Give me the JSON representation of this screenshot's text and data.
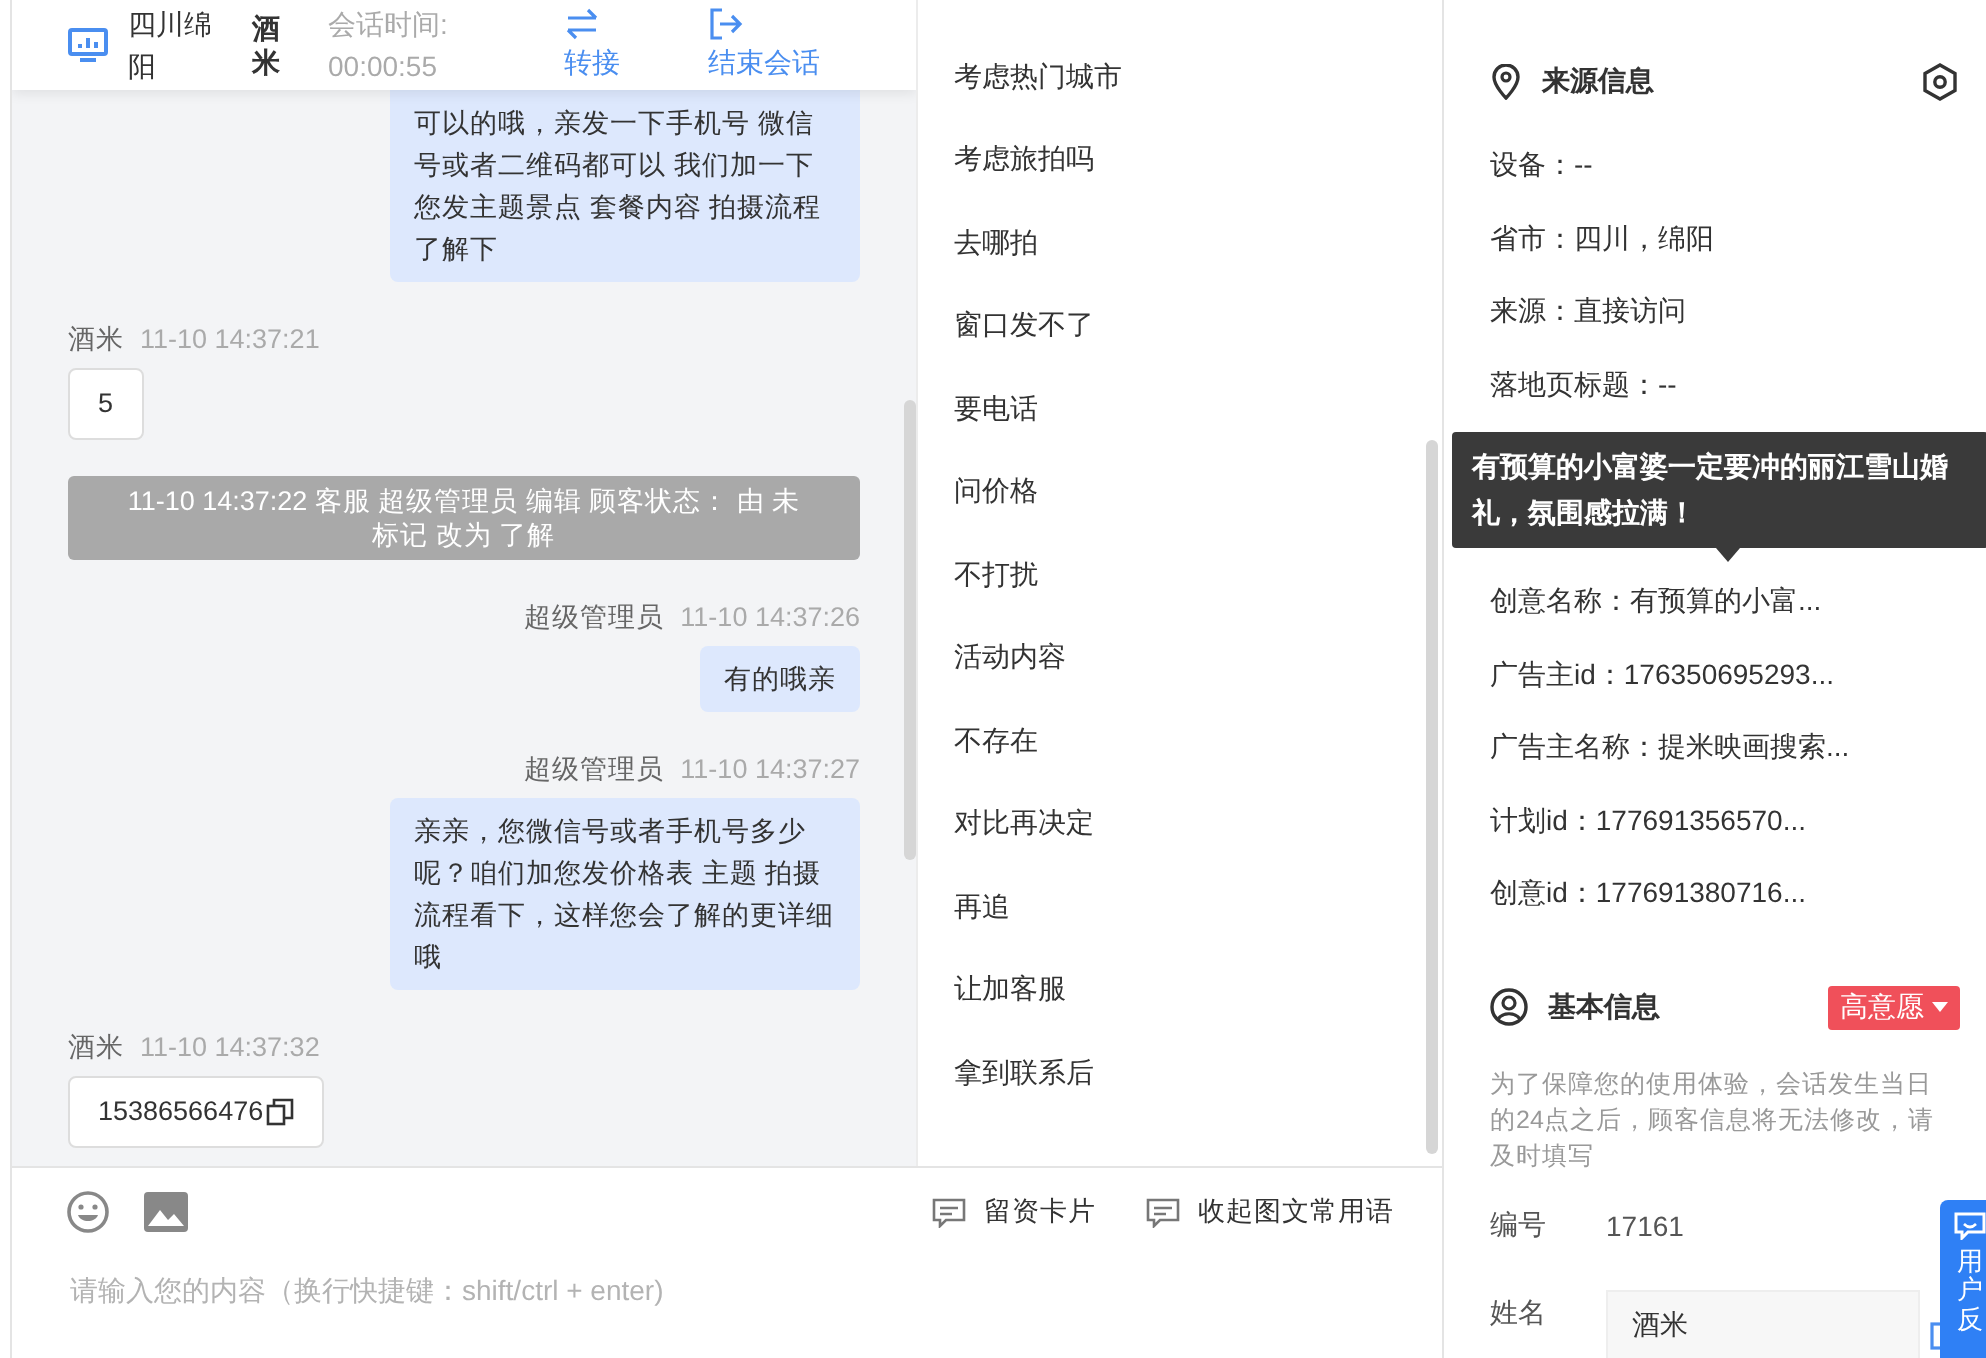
{
  "header": {
    "location": "四川绵阳",
    "customer_name": "酒米",
    "session_time_label": "会话时间:",
    "session_time": "00:00:55",
    "actions": [
      {
        "kind": "transfer",
        "label": "转接"
      },
      {
        "kind": "end",
        "label": "结束会话"
      }
    ]
  },
  "messages": [
    {
      "kind": "agent",
      "text": "可以的哦，亲发一下手机号 微信号或者二维码都可以 我们加一下您发主题景点 套餐内容 拍摄流程了解下"
    },
    {
      "kind": "customer",
      "sender": "酒米",
      "time": "11-10 14:37:21",
      "text": "5",
      "copyable": false
    },
    {
      "kind": "system",
      "text": "11-10 14:37:22 客服 超级管理员 编辑 顾客状态： 由 未标记 改为 了解"
    },
    {
      "kind": "agent",
      "sender": "超级管理员",
      "time": "11-10 14:37:26",
      "text": "有的哦亲"
    },
    {
      "kind": "agent",
      "sender": "超级管理员",
      "time": "11-10 14:37:27",
      "text": "亲亲，您微信号或者手机号多少呢？咱们加您发价格表 主题 拍摄流程看下，这样您会了解的更详细哦"
    },
    {
      "kind": "customer",
      "sender": "酒米",
      "time": "11-10 14:37:32",
      "text": "15386566476",
      "copyable": true
    }
  ],
  "quick_phrases": [
    "考虑热门城市",
    "考虑旅拍吗",
    "去哪拍",
    "窗口发不了",
    "要电话",
    "问价格",
    "不打扰",
    "活动内容",
    "不存在",
    "对比再决定",
    "再追",
    "让加客服",
    "拿到联系后"
  ],
  "composer": {
    "tools": [
      {
        "label": "留资卡片"
      },
      {
        "label": "收起图文常用语"
      }
    ],
    "placeholder": "请输入您的内容（换行快捷键：shift/ctrl + enter)"
  },
  "source_info": {
    "title": "来源信息",
    "rows": [
      {
        "kind": "row",
        "text": "设备：--"
      },
      {
        "kind": "row",
        "text": "省市：四川，绵阳"
      },
      {
        "kind": "row",
        "text": "来源：直接访问"
      },
      {
        "kind": "row",
        "text": "落地页标题：--"
      },
      {
        "kind": "tooltip",
        "text": "有预算的小富婆一定要冲的丽江雪山婚礼，氛围感拉满！"
      },
      {
        "kind": "row",
        "text": "创意名称：有预算的小富..."
      },
      {
        "kind": "row",
        "text": "广告主id：176350695293..."
      },
      {
        "kind": "row",
        "text": "广告主名称：提米映画搜索..."
      },
      {
        "kind": "row",
        "text": "计划id：177691356570..."
      },
      {
        "kind": "row",
        "text": "创意id：177691380716..."
      }
    ]
  },
  "basic_info": {
    "title": "基本信息",
    "intent_tag": "高意愿",
    "note": "为了保障您的使用体验，会话发生当日的24点之后，顾客信息将无法修改，请及时填写",
    "fields": [
      {
        "kind": "text",
        "label": "编号",
        "value": "17161"
      },
      {
        "kind": "input",
        "label": "姓名",
        "value": "酒米"
      }
    ]
  },
  "feedback_button": {
    "label": "用户反"
  }
}
